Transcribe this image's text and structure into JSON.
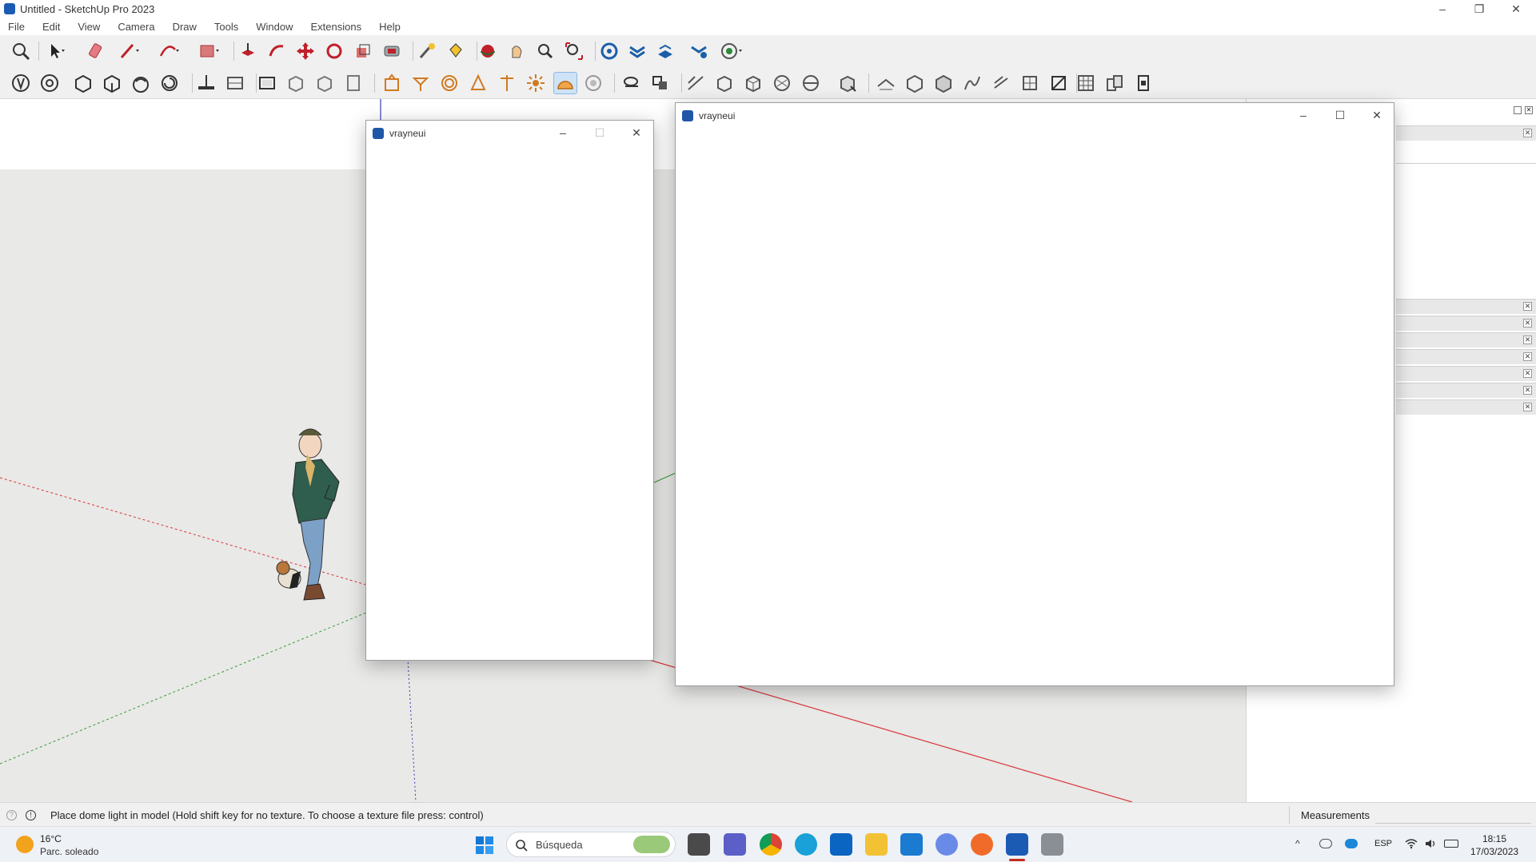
{
  "window": {
    "title": "Untitled - SketchUp Pro 2023"
  },
  "menu": [
    "File",
    "Edit",
    "View",
    "Camera",
    "Draw",
    "Tools",
    "Window",
    "Extensions",
    "Help"
  ],
  "dialogs": {
    "left": {
      "title": "vrayneui"
    },
    "right": {
      "title": "vrayneui"
    }
  },
  "status": {
    "message": "Place dome light in model (Hold shift key for no texture. To choose a texture file press: control)",
    "measurements_label": "Measurements",
    "measurements_value": ""
  },
  "taskbar": {
    "weather_temp": "16°C",
    "weather_desc": "Parc. soleado",
    "search_placeholder": "Búsqueda",
    "language": "ESP",
    "time": "18:15",
    "date": "17/03/2023"
  },
  "colors": {
    "viewport": "#e9e9e7",
    "axis_red": "#d9343a",
    "axis_green": "#3a9a3a",
    "axis_blue": "#3a3ab8",
    "sketchup_blue": "#1c5bb4"
  }
}
